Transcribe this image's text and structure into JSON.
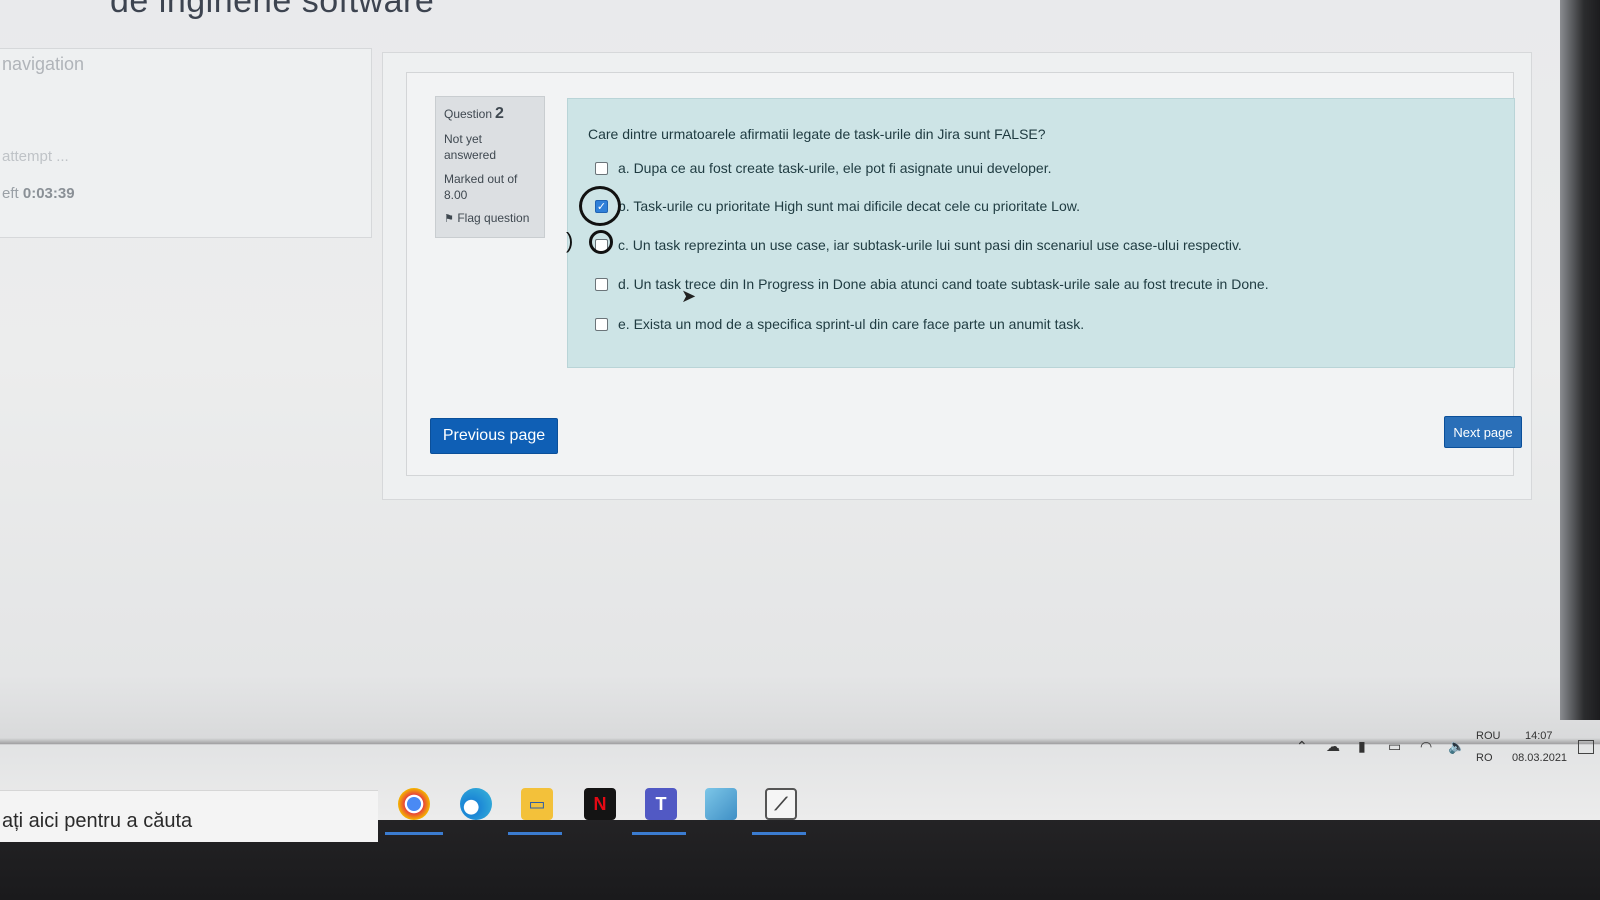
{
  "header": {
    "title": "de inginerie software"
  },
  "sidebar": {
    "nav_title": "navigation",
    "attempt_link": "attempt ...",
    "time_left_label": "eft",
    "time_left_value": "0:03:39"
  },
  "question": {
    "label": "Question",
    "number": "2",
    "state_line1": "Not yet",
    "state_line2": "answered",
    "grade_line1": "Marked out of",
    "grade_line2": "8.00",
    "flag_label": "Flag question",
    "text": "Care dintre urmatoarele afirmatii legate de task-urile din Jira sunt FALSE?",
    "answers": [
      {
        "text": "a. Dupa ce au fost create task-urile, ele pot fi asignate unui developer.",
        "checked": false
      },
      {
        "text": "b. Task-urile cu prioritate High sunt mai dificile decat cele cu prioritate Low.",
        "checked": true
      },
      {
        "text": "c. Un task reprezinta un use case, iar subtask-urile lui sunt pasi din scenariul use case-ului respectiv.",
        "checked": false
      },
      {
        "text": "d. Un task trece din In Progress in Done abia atunci cand toate subtask-urile sale au fost trecute in Done.",
        "checked": false
      },
      {
        "text": "e. Exista un mod de a specifica sprint-ul din care face parte un anumit task.",
        "checked": false
      }
    ]
  },
  "navigation_buttons": {
    "previous": "Previous page",
    "next": "Next page"
  },
  "taskbar": {
    "search_text": "ați aici pentru a căuta",
    "apps": [
      "chrome-icon",
      "edge-icon",
      "file-explorer-icon",
      "netflix-icon",
      "teams-icon",
      "app-icon",
      "snipping-tool-icon"
    ],
    "lang_line1": "ROU",
    "lang_line2": "RO",
    "time": "14:07",
    "date": "08.03.2021"
  },
  "colors": {
    "primary_button": "#0f5fb5",
    "question_bg": "#cde4e6",
    "checkbox_checked": "#2f80d9"
  }
}
